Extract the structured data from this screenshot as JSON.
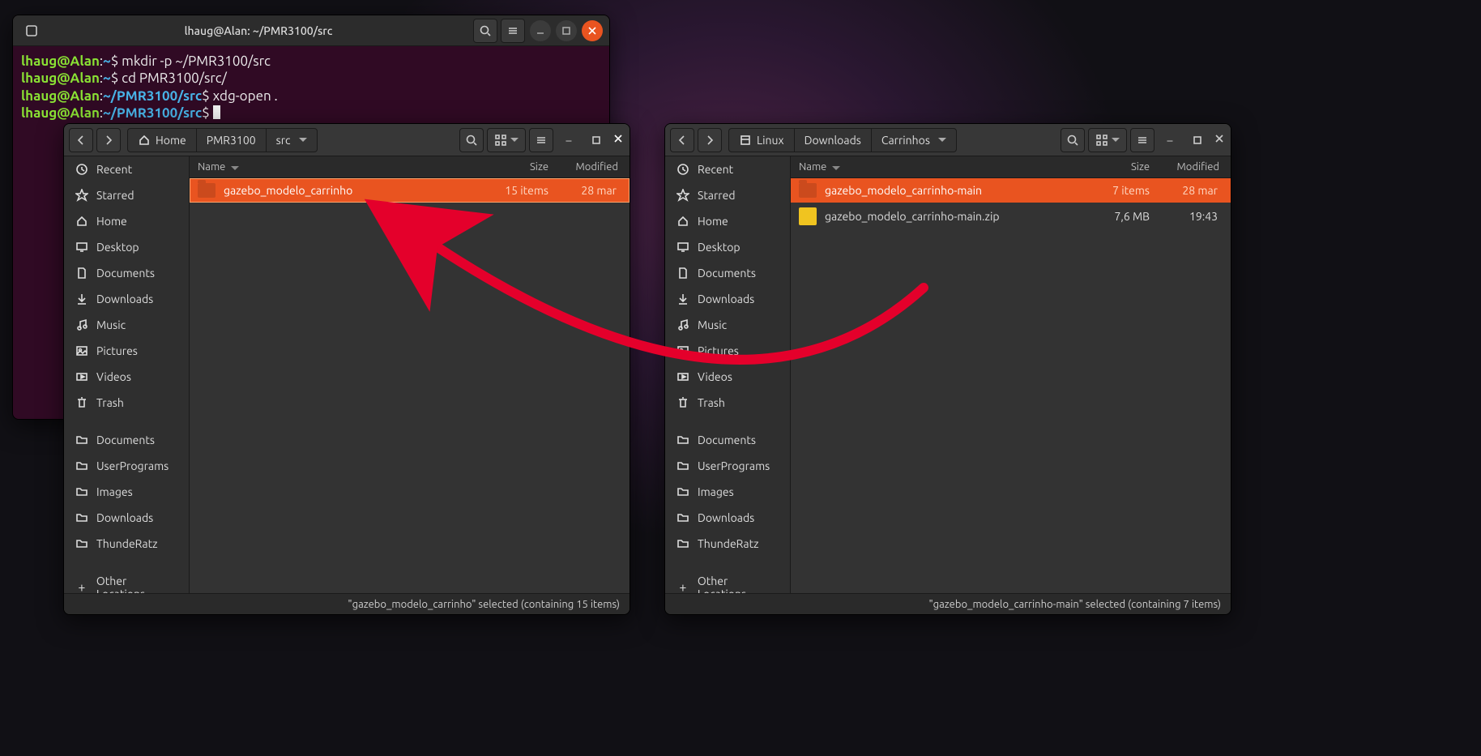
{
  "terminal": {
    "title": "lhaug@Alan: ~/PMR3100/src",
    "user": "lhaug",
    "host": "Alan",
    "home_prompt": "~",
    "path_prompt": "~/PMR3100/src",
    "cmd1": "mkdir -p ~/PMR3100/src",
    "cmd2": "cd PMR3100/src/",
    "cmd3": "xdg-open ."
  },
  "fm": {
    "columns": {
      "name": "Name",
      "size": "Size",
      "modified": "Modified"
    }
  },
  "fm1": {
    "path": [
      "Home",
      "PMR3100",
      "src"
    ],
    "rows": [
      {
        "name": "gazebo_modelo_carrinho",
        "size": "15 items",
        "mod": "28 mar",
        "type": "folder",
        "selected": true
      }
    ],
    "status": "\"gazebo_modelo_carrinho\" selected  (containing 15 items)"
  },
  "fm2": {
    "path": [
      "Linux",
      "Downloads",
      "Carrinhos"
    ],
    "rows": [
      {
        "name": "gazebo_modelo_carrinho-main",
        "size": "7 items",
        "mod": "28 mar",
        "type": "folder",
        "selected": true
      },
      {
        "name": "gazebo_modelo_carrinho-main.zip",
        "size": "7,6 MB",
        "mod": "19:43",
        "type": "zip",
        "selected": false
      }
    ],
    "status": "\"gazebo_modelo_carrinho-main\" selected  (containing 7 items)"
  },
  "sidebar": {
    "recent": "Recent",
    "starred": "Starred",
    "home": "Home",
    "desktop": "Desktop",
    "documents": "Documents",
    "downloads": "Downloads",
    "music": "Music",
    "pictures": "Pictures",
    "videos": "Videos",
    "trash": "Trash",
    "bm_documents": "Documents",
    "bm_userprograms": "UserPrograms",
    "bm_images": "Images",
    "bm_downloads": "Downloads",
    "bm_thunderatz": "ThundeRatz",
    "other": "Other Locations"
  }
}
